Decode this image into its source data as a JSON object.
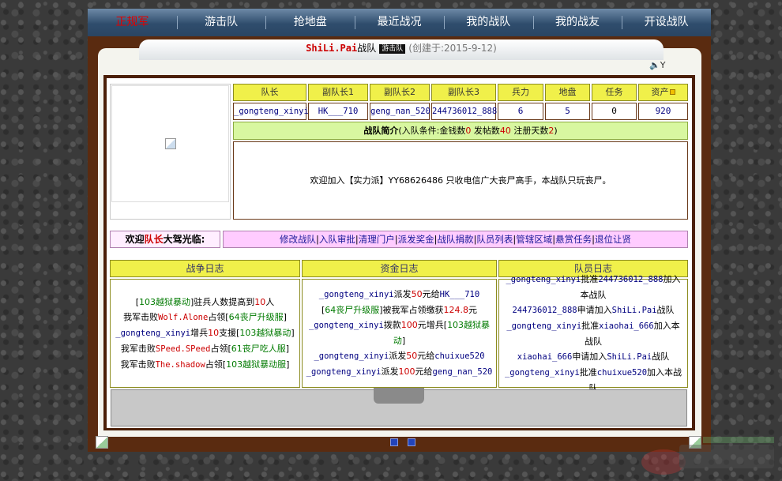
{
  "nav": {
    "items": [
      "正规军",
      "游击队",
      "抢地盘",
      "最近战况",
      "我的战队",
      "我的战友",
      "开设战队"
    ]
  },
  "team": {
    "name": "ShiLi.Pai",
    "suffix": "战队",
    "badge": "游击队",
    "created": "(创建于:2015-9-12)"
  },
  "sound_label": "Y",
  "stats": {
    "headers": [
      "队长",
      "副队长1",
      "副队长2",
      "副队长3",
      "兵力",
      "地盘",
      "任务",
      "资产"
    ],
    "values": [
      "_gongteng_xinyi",
      "HK___710",
      "geng_nan_520",
      "244736012_888",
      "6",
      "5",
      "0",
      "920"
    ]
  },
  "intro": {
    "title": "战队简介",
    "cond_prefix": "(入队条件:金钱数",
    "money": "0",
    "posts_label": "发帖数",
    "posts": "40",
    "days_label": "注册天数",
    "days": "2",
    "cond_suffix": ")",
    "text": "欢迎加入【实力派】YY68626486 只收电信广大丧尸高手，本战队只玩丧尸。"
  },
  "welcome": {
    "prefix": "欢迎",
    "role": "队长",
    "suffix": "大驾光临:"
  },
  "admin_links": [
    "修改战队",
    "入队审批",
    "清理门户",
    "派发奖金",
    "战队捐款",
    "队员列表",
    "管辖区域",
    "悬赏任务",
    "退位让贤"
  ],
  "logs": {
    "war_title": "战争日志",
    "fund_title": "资金日志",
    "member_title": "队员日志"
  },
  "war_log": [
    [
      "[",
      "103越狱暴动",
      "]驻兵人数提高到",
      "10",
      "人"
    ],
    [
      "我军击败",
      "Wolf.Alone",
      "占领[",
      "64丧尸升级服",
      "]"
    ],
    [
      "_gongteng_xinyi",
      "增兵",
      "10",
      "支援[",
      "103越狱暴动",
      "]"
    ],
    [
      "我军击败",
      "SPeed.SPeed",
      "占领[",
      "61丧尸吃人服",
      "]"
    ],
    [
      "我军击败",
      "The.shadow",
      "占领[",
      "103越狱暴动服",
      "]"
    ]
  ],
  "fund_log": [
    [
      "_gongteng_xinyi",
      "派发",
      "50",
      "元给",
      "HK___710"
    ],
    [
      "[",
      "64丧尸升级服",
      "]被我军占领缴获",
      "124.8",
      "元"
    ],
    [
      "_gongteng_xinyi",
      "拨款",
      "100",
      "元增兵[",
      "103越狱暴动",
      "]"
    ],
    [
      "_gongteng_xinyi",
      "派发",
      "50",
      "元给",
      "chuixue520"
    ],
    [
      "_gongteng_xinyi",
      "派发",
      "100",
      "元给",
      "geng_nan_520"
    ]
  ],
  "member_log": [
    [
      "_gongteng_xinyi",
      "批准",
      "244736012_888",
      "加入本战队"
    ],
    [
      "244736012_888",
      "申请加入",
      "ShiLi.Pai",
      "战队"
    ],
    [
      "_gongteng_xinyi",
      "批准",
      "xiaohai_666",
      "加入本战队"
    ],
    [
      "xiaohai_666",
      "申请加入",
      "ShiLi.Pai",
      "战队"
    ],
    [
      "_gongteng_xinyi",
      "批准",
      "chuixue520",
      "加入本战队"
    ]
  ],
  "colors": {
    "nav_bg": "#2f4d6d",
    "frame": "#5a2b10",
    "header_yellow": "#f0f04a",
    "intro_green": "#d8f7a0",
    "admin_pink": "#ffccff"
  }
}
